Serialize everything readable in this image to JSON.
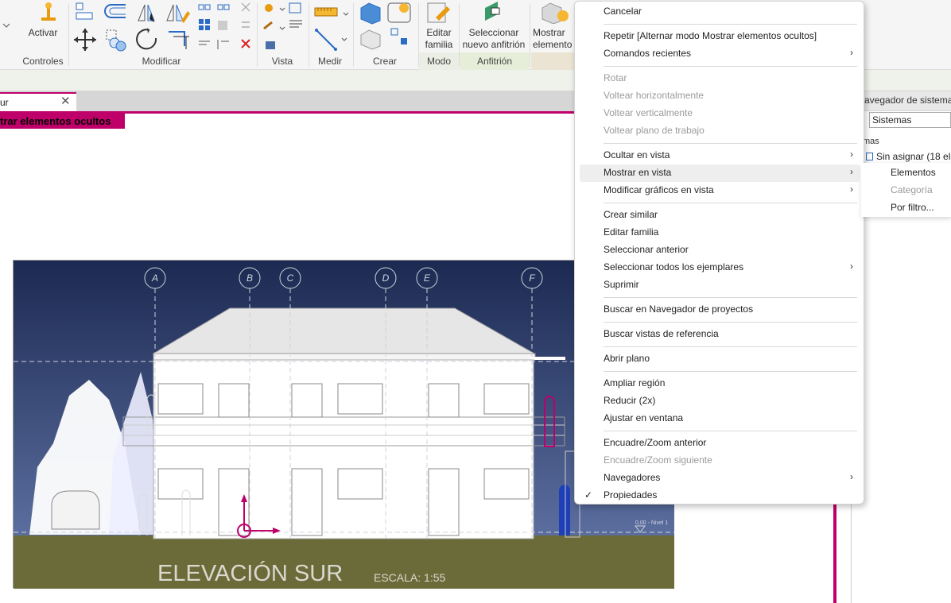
{
  "ribbon": {
    "panels": [
      "Controles",
      "Modificar",
      "Vista",
      "Medir",
      "Crear",
      "Modo",
      "Anfitrión"
    ],
    "activar": "Activar",
    "editar_familia": [
      "Editar",
      "familia"
    ],
    "seleccionar_anfitrion": [
      "Seleccionar",
      "nuevo anfitrión"
    ],
    "mostrar_elementos": [
      "Mostrar",
      "elemento"
    ]
  },
  "view_tab": {
    "label": "ur"
  },
  "banner": {
    "hidden_elements": "trar elementos ocultos"
  },
  "drawing": {
    "grid_labels": [
      "A",
      "B",
      "C",
      "D",
      "E",
      "F"
    ],
    "title": "ELEVACIÓN SUR",
    "scale": "ESCALA: 1:55",
    "level": "0,00 - Nivel 1",
    "colors": {
      "sky_top": "#1c2a52",
      "sky_bottom": "#5c6fa0",
      "ground": "#6b6b3a",
      "highlight": "#c0006a"
    }
  },
  "browser": {
    "title": "avegador de sistema",
    "select_value": "Sistemas",
    "tree_header": "mas",
    "tree_item": "Sin asignar (18 ele"
  },
  "context_menu": {
    "items": [
      {
        "label": "Cancelar"
      },
      {
        "label": "Repetir [Alternar modo Mostrar elementos ocultos]"
      },
      {
        "label": "Comandos recientes",
        "submenu": true
      },
      {
        "label": "Rotar",
        "disabled": true
      },
      {
        "label": "Voltear horizontalmente",
        "disabled": true
      },
      {
        "label": "Voltear verticalmente",
        "disabled": true
      },
      {
        "label": "Voltear plano de trabajo",
        "disabled": true
      },
      {
        "label": "Ocultar en vista",
        "submenu": true
      },
      {
        "label": "Mostrar en vista",
        "submenu": true,
        "highlighted": true
      },
      {
        "label": "Modificar gráficos en vista",
        "submenu": true
      },
      {
        "label": "Crear similar"
      },
      {
        "label": "Editar familia"
      },
      {
        "label": "Seleccionar anterior"
      },
      {
        "label": "Seleccionar todos los ejemplares",
        "submenu": true
      },
      {
        "label": "Suprimir"
      },
      {
        "label": "Buscar en Navegador de proyectos"
      },
      {
        "label": "Buscar vistas de referencia"
      },
      {
        "label": "Abrir plano"
      },
      {
        "label": "Ampliar región"
      },
      {
        "label": "Reducir (2x)"
      },
      {
        "label": "Ajustar en ventana"
      },
      {
        "label": "Encuadre/Zoom anterior"
      },
      {
        "label": "Encuadre/Zoom siguiente",
        "disabled": true
      },
      {
        "label": "Navegadores",
        "submenu": true
      },
      {
        "label": "Propiedades",
        "checked": true
      }
    ],
    "arrow_glyph": "›",
    "check_glyph": "✓"
  },
  "submenu": {
    "items": [
      {
        "label": "Elementos"
      },
      {
        "label": "Categoría",
        "disabled": true
      },
      {
        "label": "Por filtro..."
      }
    ]
  },
  "close_glyph": "✕"
}
